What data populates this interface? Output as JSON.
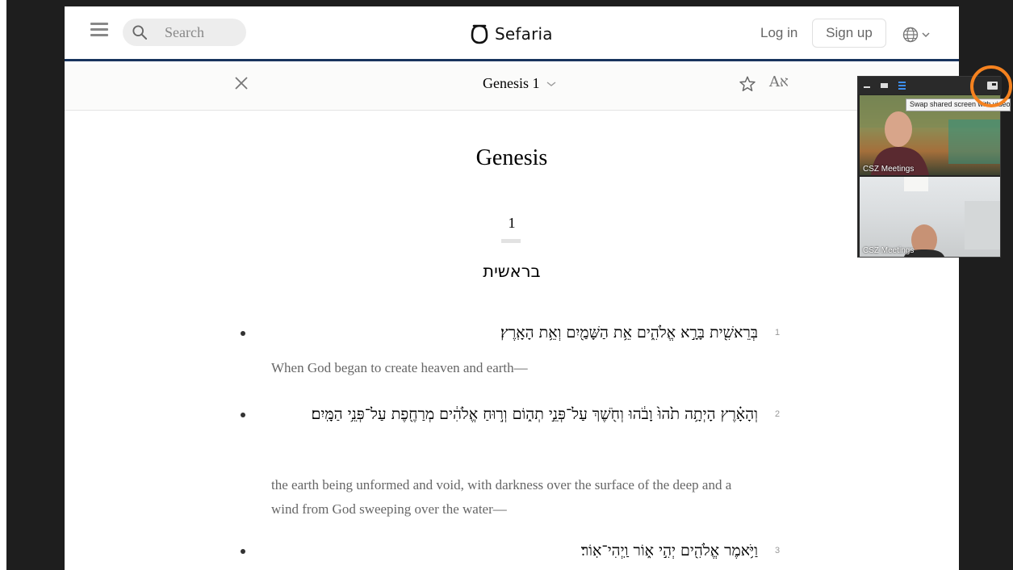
{
  "header": {
    "search_placeholder": "Search",
    "logo_text": "Sefaria",
    "login_label": "Log in",
    "signup_label": "Sign up"
  },
  "reader_bar": {
    "reference": "Genesis 1",
    "lang_toggle": "Aא"
  },
  "text": {
    "book_title": "Genesis",
    "chapter": "1",
    "hebrew_heading": "בראשית",
    "verses": [
      {
        "num": "1",
        "hebrew": "בְּרֵאשִׁ֖ית בָּרָ֣א אֱלֹהִ֑ים אֵ֥ת הַשָּׁמַ֖יִם וְאֵ֥ת הָאָֽרֶץ׃",
        "english": "When God began to create heaven and earth—"
      },
      {
        "num": "2",
        "hebrew": "וְהָאָ֗רֶץ הָיְתָ֥ה תֹ֙הוּ֙ וָבֹ֔הוּ וְחֹ֖שֶׁךְ עַל־פְּנֵ֣י תְה֑וֹם וְר֣וּחַ אֱלֹהִ֔ים מְרַחֶ֖פֶת עַל־פְּנֵ֥י הַמָּֽיִם׃",
        "english": "the earth being unformed and void, with darkness over the surface of the deep and a wind from God sweeping over the water—"
      },
      {
        "num": "3",
        "hebrew": "וַיֹּ֥אמֶר אֱלֹהִ֖ים יְהִ֣י א֑וֹר וַֽיְהִי־אֽוֹר׃",
        "english": ""
      }
    ]
  },
  "zoom": {
    "tooltip": "Swap shared screen with video",
    "participants": [
      {
        "label": "CSZ Meetings"
      },
      {
        "label": "CSZ Meetings"
      }
    ],
    "colors": {
      "highlight_ring": "#f5821f",
      "active_view": "#3d8ef0"
    }
  }
}
